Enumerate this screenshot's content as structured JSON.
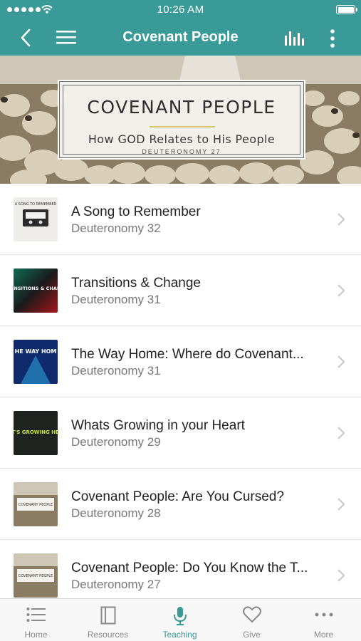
{
  "status_bar": {
    "time": "10:26 AM"
  },
  "nav": {
    "title": "Covenant People"
  },
  "banner": {
    "title": "COVENANT PEOPLE",
    "subtitle": "How GOD Relates to His People",
    "reference": "DEUTERONOMY 27"
  },
  "sermons": [
    {
      "title": "A Song to Remember",
      "subtitle": "Deuteronomy 32",
      "thumb_text": "A SONG TO REMEMBER"
    },
    {
      "title": "Transitions & Change",
      "subtitle": "Deuteronomy 31",
      "thumb_text": "TRANSITIONS & CHANGE"
    },
    {
      "title": "The Way Home: Where do Covenant...",
      "subtitle": "Deuteronomy 31",
      "thumb_text": "HE WAY HOM"
    },
    {
      "title": "Whats Growing in your Heart",
      "subtitle": "Deuteronomy 29",
      "thumb_text": "WHAT'S GROWING HEART?"
    },
    {
      "title": "Covenant People: Are You Cursed?",
      "subtitle": "Deuteronomy 28",
      "thumb_text": "COVENANT PEOPLE"
    },
    {
      "title": "Covenant People: Do You Know the T...",
      "subtitle": "Deuteronomy 27",
      "thumb_text": "COVENANT PEOPLE"
    }
  ],
  "tabs": [
    {
      "label": "Home",
      "icon": "list-icon"
    },
    {
      "label": "Resources",
      "icon": "book-icon"
    },
    {
      "label": "Teaching",
      "icon": "microphone-icon"
    },
    {
      "label": "Give",
      "icon": "heart-icon"
    },
    {
      "label": "More",
      "icon": "ellipsis-icon"
    }
  ],
  "active_tab": "Teaching",
  "colors": {
    "brand": "#3a9a97",
    "tab_inactive": "#8a8a8a"
  }
}
